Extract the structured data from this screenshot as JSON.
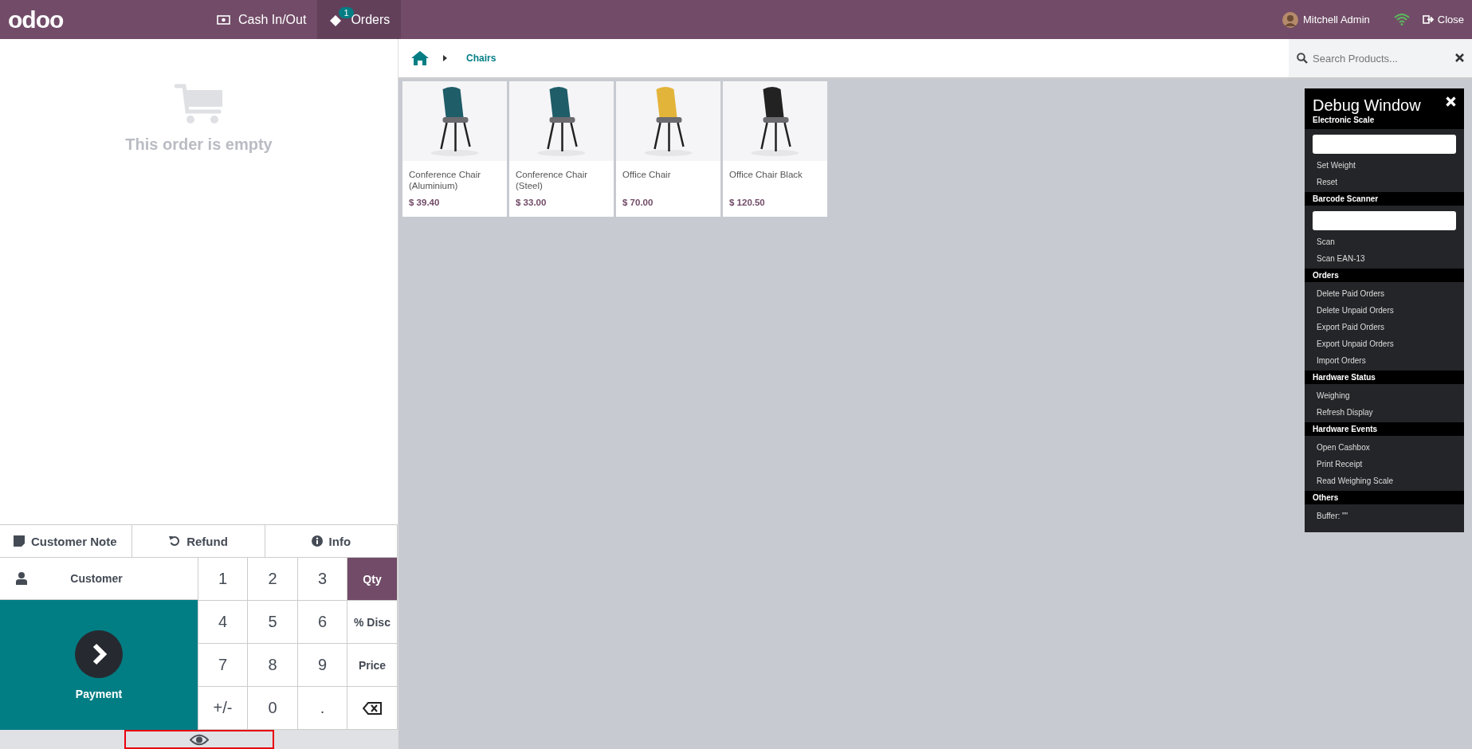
{
  "header": {
    "logo": "odoo",
    "nav": [
      {
        "kind": "cash",
        "label": "Cash In/Out",
        "selected": false
      },
      {
        "kind": "orders",
        "label": "Orders",
        "selected": true,
        "badge": "1"
      }
    ],
    "user": "Mitchell Admin",
    "close": "Close"
  },
  "order": {
    "empty_text": "This order is empty"
  },
  "actions": [
    {
      "kind": "note",
      "label": "Customer Note"
    },
    {
      "kind": "refund",
      "label": "Refund"
    },
    {
      "kind": "info",
      "label": "Info"
    }
  ],
  "customer": "Customer",
  "payment": "Payment",
  "numpad": [
    {
      "kind": "digit",
      "label": "1",
      "selected": false
    },
    {
      "kind": "digit",
      "label": "2",
      "selected": false
    },
    {
      "kind": "digit",
      "label": "3",
      "selected": false
    },
    {
      "kind": "mode",
      "label": "Qty",
      "selected": true
    },
    {
      "kind": "digit",
      "label": "4",
      "selected": false
    },
    {
      "kind": "digit",
      "label": "5",
      "selected": false
    },
    {
      "kind": "digit",
      "label": "6",
      "selected": false
    },
    {
      "kind": "mode",
      "label": "% Disc",
      "selected": false
    },
    {
      "kind": "digit",
      "label": "7",
      "selected": false
    },
    {
      "kind": "digit",
      "label": "8",
      "selected": false
    },
    {
      "kind": "digit",
      "label": "9",
      "selected": false
    },
    {
      "kind": "mode",
      "label": "Price",
      "selected": false
    },
    {
      "kind": "digit",
      "label": "+/-",
      "selected": false
    },
    {
      "kind": "digit",
      "label": "0",
      "selected": false
    },
    {
      "kind": "digit",
      "label": ".",
      "selected": false
    },
    {
      "kind": "backspace"
    }
  ],
  "breadcrumb": {
    "current": "Chairs"
  },
  "search": {
    "placeholder": "Search Products..."
  },
  "products": [
    {
      "name": "Conference Chair (Aluminium)",
      "price": "$ 39.40",
      "kind": "picture"
    },
    {
      "name": "Conference Chair (Steel)",
      "price": "$ 33.00",
      "kind": "picture"
    },
    {
      "name": "Office Chair",
      "price": "$ 70.00",
      "kind": "picture"
    },
    {
      "name": "Office Chair Black",
      "price": "$ 120.50",
      "kind": "picture"
    }
  ],
  "debug": {
    "title": "Debug Window",
    "sections": [
      {
        "title": "Electronic Scale",
        "items": [
          {
            "kind": "input"
          },
          {
            "kind": "action",
            "label": "Set Weight"
          },
          {
            "kind": "action",
            "label": "Reset"
          }
        ]
      },
      {
        "title": "Barcode Scanner",
        "items": [
          {
            "kind": "input"
          },
          {
            "kind": "action",
            "label": "Scan"
          },
          {
            "kind": "action",
            "label": "Scan EAN-13"
          }
        ]
      },
      {
        "title": "Orders",
        "items": [
          {
            "kind": "action",
            "label": "Delete Paid Orders"
          },
          {
            "kind": "action",
            "label": "Delete Unpaid Orders"
          },
          {
            "kind": "action",
            "label": "Export Paid Orders"
          },
          {
            "kind": "action",
            "label": "Export Unpaid Orders"
          },
          {
            "kind": "action",
            "label": "Import Orders"
          }
        ]
      },
      {
        "title": "Hardware Status",
        "items": [
          {
            "kind": "action",
            "label": "Weighing"
          },
          {
            "kind": "action",
            "label": "Refresh Display"
          }
        ]
      },
      {
        "title": "Hardware Events",
        "items": [
          {
            "kind": "action",
            "label": "Open Cashbox"
          },
          {
            "kind": "action",
            "label": "Print Receipt"
          },
          {
            "kind": "action",
            "label": "Read Weighing Scale"
          }
        ]
      },
      {
        "title": "Others",
        "items": [
          {
            "kind": "text",
            "label": "Buffer: \"\""
          }
        ]
      }
    ]
  }
}
